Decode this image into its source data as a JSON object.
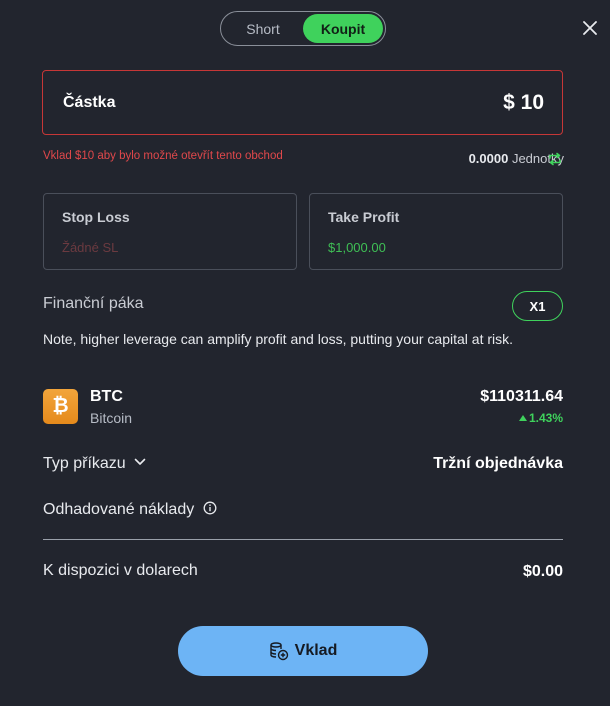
{
  "toggle": {
    "short": "Short",
    "buy": "Koupit",
    "active": "buy"
  },
  "amount": {
    "label": "Částka",
    "value": "$ 10"
  },
  "warning": "Vklad $10 aby bylo možné otevřít tento obchod",
  "units": {
    "value": "0.0000",
    "label": "Jednotky"
  },
  "stop_loss": {
    "title": "Stop Loss",
    "value": "Žádné SL"
  },
  "take_profit": {
    "title": "Take Profit",
    "value": "$1,000.00"
  },
  "leverage": {
    "title": "Finanční páka",
    "badge": "X1"
  },
  "note": "Note, higher leverage can amplify profit and loss, putting your capital at risk.",
  "asset": {
    "symbol": "BTC",
    "name": "Bitcoin",
    "price": "$110311.64",
    "change": "1.43%",
    "icon_glyph": "₿"
  },
  "order_type": {
    "label": "Typ příkazu",
    "value": "Tržní objednávka"
  },
  "estimated_costs": {
    "label": "Odhadované náklady"
  },
  "available": {
    "label": "K dispozici v dolarech",
    "value": "$0.00"
  },
  "deposit_button": "Vklad",
  "colors": {
    "accent_green": "#3fd25c",
    "error_red": "#c63737",
    "button_blue": "#6db4f5",
    "background": "#22252e"
  }
}
